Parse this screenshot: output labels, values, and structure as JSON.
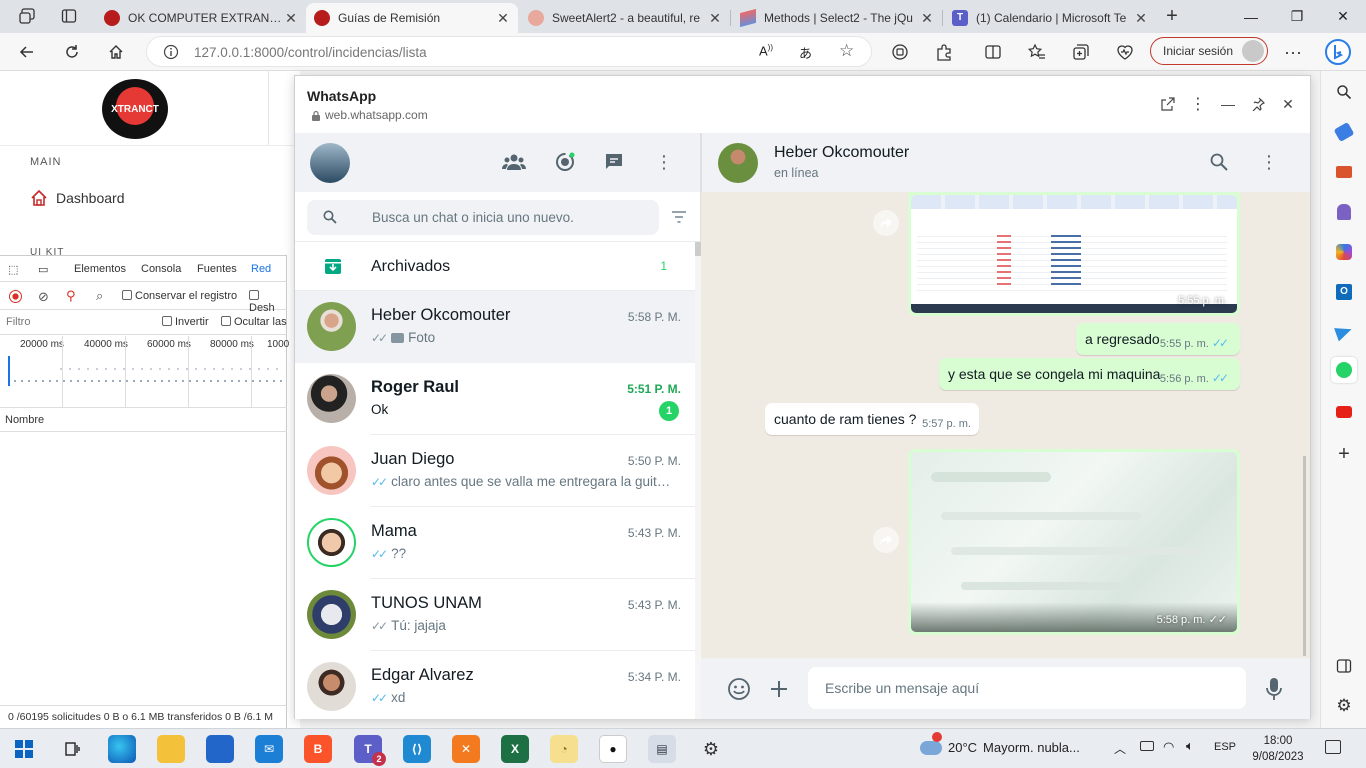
{
  "browser": {
    "tabs": [
      {
        "title": "OK COMPUTER EXTRANET",
        "active": false
      },
      {
        "title": "Guías de Remisión",
        "active": true
      },
      {
        "title": "SweetAlert2 - a beautiful, re",
        "active": false
      },
      {
        "title": "Methods | Select2 - The jQu",
        "active": false
      },
      {
        "title": "(1) Calendario | Microsoft Te",
        "active": false
      }
    ],
    "url_host": "127.0.0.1",
    "url_rest": ":8000/control/incidencias/lista",
    "signin_label": "Iniciar sesión"
  },
  "page": {
    "logo_text": "XTRANCT",
    "section_main": "MAIN",
    "dashboard_label": "Dashboard",
    "section_uikit": "UI KIT"
  },
  "devtools": {
    "tabs": [
      "Elementos",
      "Consola",
      "Fuentes",
      "Red"
    ],
    "preserve_log": "Conservar el registro",
    "disable_cache": "Desh",
    "filter_placeholder": "Filtro",
    "invert": "Invertir",
    "hide": "Ocultar las",
    "timeline_ticks": [
      "20000 ms",
      "40000 ms",
      "60000 ms",
      "80000 ms",
      "1000"
    ],
    "name_column": "Nombre",
    "status": "0 /60195 solicitudes   0 B o 6.1 MB transferidos   0 B /6.1 M"
  },
  "whatsapp": {
    "window_title": "WhatsApp",
    "domain": "web.whatsapp.com",
    "search_placeholder": "Busca un chat o inicia uno nuevo.",
    "archived_label": "Archivados",
    "archived_count": "1",
    "chats": [
      {
        "name": "Heber Okcomouter",
        "time": "5:58 P. M.",
        "preview": "Foto",
        "ticks": "grey",
        "photo": true,
        "selected": true,
        "unread": "",
        "bold": false
      },
      {
        "name": "Roger Raul",
        "time": "5:51 P. M.",
        "preview": "Ok",
        "ticks": "",
        "photo": false,
        "selected": false,
        "unread": "1",
        "bold": true
      },
      {
        "name": "Juan Diego",
        "time": "5:50 P. M.",
        "preview": "claro antes que se valla me entregara la guit…",
        "ticks": "blue",
        "photo": false,
        "selected": false,
        "unread": "",
        "bold": false
      },
      {
        "name": "Mama",
        "time": "5:43 P. M.",
        "preview": "??",
        "ticks": "blue",
        "photo": false,
        "selected": false,
        "unread": "",
        "bold": false
      },
      {
        "name": "TUNOS UNAM",
        "time": "5:43 P. M.",
        "preview": "Tú: jajaja",
        "ticks": "grey",
        "photo": false,
        "selected": false,
        "unread": "",
        "bold": false
      },
      {
        "name": "Edgar Alvarez",
        "time": "5:34 P. M.",
        "preview": "xd",
        "ticks": "blue",
        "photo": false,
        "selected": false,
        "unread": "",
        "bold": false
      }
    ],
    "contact_name": "Heber Okcomouter",
    "contact_status": "en línea",
    "messages": [
      {
        "type": "image",
        "dir": "out",
        "time": "5:55 p. m."
      },
      {
        "type": "text",
        "dir": "out",
        "text": "a regresado",
        "time": "5:55 p. m."
      },
      {
        "type": "text",
        "dir": "out",
        "text": "y esta que se congela mi maquina",
        "time": "5:56 p. m."
      },
      {
        "type": "text",
        "dir": "in",
        "text": "cuanto de ram tienes ?",
        "time": "5:57 p. m."
      },
      {
        "type": "image",
        "dir": "out",
        "time": "5:58 p. m."
      }
    ],
    "composer_placeholder": "Escribe un mensaje aquí"
  },
  "taskbar": {
    "weather_temp": "20°C",
    "weather_desc": "Mayorm. nubla...",
    "language": "ESP",
    "time": "18:00",
    "date": "9/08/2023",
    "teams_badge": "2"
  },
  "colors": {
    "wa_green": "#25d366",
    "wa_bubble_out": "#d9fdd3",
    "wa_chat_bg": "#efeae2",
    "edge_signin_border": "#c0392b"
  }
}
